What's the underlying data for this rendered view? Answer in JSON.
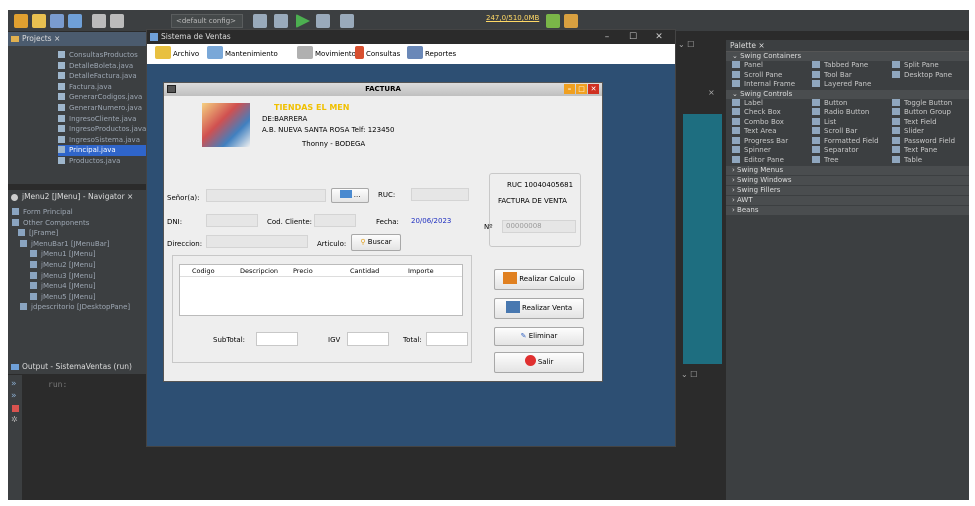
{
  "ide": {
    "config_dropdown": "<default config>",
    "memory": "247,0/510,0MB",
    "projects_tab": "Projects",
    "project_files": [
      "ConsultasProductos",
      "DetalleBoleta.java",
      "DetalleFactura.java",
      "Factura.java",
      "GenerarCodigos.java",
      "GenerarNumero.java",
      "IngresoCliente.java",
      "IngresoProductos.java",
      "IngresoSistema.java",
      "Principal.java",
      "Productos.java"
    ],
    "navigator_tab": "jMenu2 [JMenu] - Navigator",
    "navigator_items": [
      "Form Principal",
      "Other Components",
      "[JFrame]",
      "jMenuBar1 [JMenuBar]",
      "jMenu1 [JMenu]",
      "jMenu2 [JMenu]",
      "jMenu3 [JMenu]",
      "jMenu4 [JMenu]",
      "jMenu5 [JMenu]",
      "jdpescritorio [JDesktopPane]"
    ],
    "output_tab": "Output - SistemaVentas (run)",
    "output_text": "run:",
    "palette": {
      "title": "Palette",
      "swing_containers_label": "Swing Containers",
      "swing_containers": [
        "Panel",
        "Tabbed Pane",
        "Split Pane",
        "Scroll Pane",
        "Tool Bar",
        "Desktop Pane",
        "Internal Frame",
        "Layered Pane",
        ""
      ],
      "swing_controls_label": "Swing Controls",
      "swing_controls": [
        "Label",
        "Button",
        "Toggle Button",
        "Check Box",
        "Radio Button",
        "Button Group",
        "Combo Box",
        "List",
        "Text Field",
        "Text Area",
        "Scroll Bar",
        "Slider",
        "Progress Bar",
        "Formatted Field",
        "Password Field",
        "Spinner",
        "Separator",
        "Text Pane",
        "Editor Pane",
        "Tree",
        "Table"
      ],
      "collapsed": [
        "Swing Menus",
        "Swing Windows",
        "Swing Fillers",
        "AWT",
        "Beans"
      ]
    }
  },
  "app": {
    "window_title": "Sistema de Ventas",
    "menus": [
      "Archivo",
      "Mantenimiento",
      "Movimiento",
      "Consultas",
      "Reportes"
    ]
  },
  "factura": {
    "title": "FACTURA",
    "store_name": "TIENDAS EL MEN",
    "store_line1": "DE:BARRERA",
    "store_line2": "A.B. NUEVA SANTA ROSA  Telf: 123450",
    "store_line3": "Thonny - BODEGA",
    "ruc_box_line1": "RUC 10040405681",
    "ruc_box_line2": "FACTURA DE VENTA",
    "nro_label": "Nº",
    "nro_value": "00000008",
    "senor_label": "Señor(a):",
    "ruc_label": "RUC:",
    "search_btn": "...",
    "dni_label": "DNI:",
    "cod_cliente_label": "Cod. Cliente:",
    "fecha_label": "Fecha:",
    "fecha_value": "20/06/2023",
    "direccion_label": "Direccion:",
    "articulo_label": "Articulo:",
    "buscar_btn": "Buscar",
    "table_headers": [
      "Codigo",
      "Descripcion",
      "Precio",
      "Cantidad",
      "Importe"
    ],
    "subtotal_label": "SubTotal:",
    "igv_label": "IGV",
    "total_label": "Total:",
    "btn_calculo": "Realizar Calculo",
    "btn_venta": "Realizar Venta",
    "btn_eliminar": "Eliminar",
    "btn_salir": "Salir"
  }
}
